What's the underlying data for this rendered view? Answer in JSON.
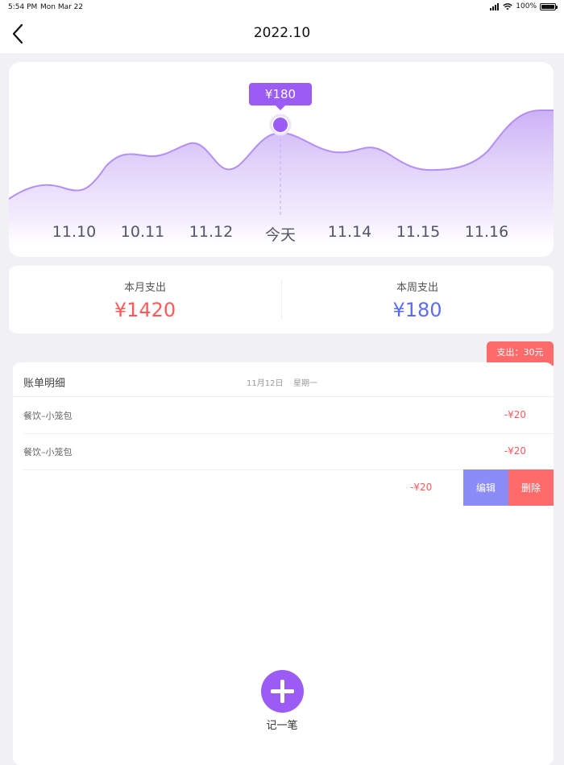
{
  "status_bar": {
    "time": "5:54 PM",
    "date": "Mon Mar 22",
    "battery": "100%"
  },
  "nav": {
    "title": "2022.10"
  },
  "chart_data": {
    "type": "area",
    "x": [
      "11.10",
      "10.11",
      "11.12",
      "今天",
      "11.14",
      "11.15",
      "11.16"
    ],
    "highlight_index": 3,
    "tooltip": "¥180",
    "colors": {
      "line": "#b48ef5",
      "fill_top": "#cdb4f7",
      "point": "#9b5cf6"
    }
  },
  "summary": {
    "month_label": "本月支出",
    "month_value": "¥1420",
    "month_color": "#ff5a5a",
    "week_label": "本周支出",
    "week_value": "¥180",
    "week_color": "#5b6cf0"
  },
  "expense_tag": "支出：30元",
  "bill": {
    "title": "账单明细",
    "date": "11月12日",
    "weekday": "星期一",
    "rows": [
      {
        "name": "餐饮–小笼包",
        "amount": "-¥20"
      },
      {
        "name": "餐饮–小笼包",
        "amount": "-¥20"
      }
    ],
    "swipe_row": {
      "amount": "-¥20",
      "edit_label": "编辑",
      "delete_label": "删除"
    }
  },
  "add": {
    "label": "记一笔"
  }
}
